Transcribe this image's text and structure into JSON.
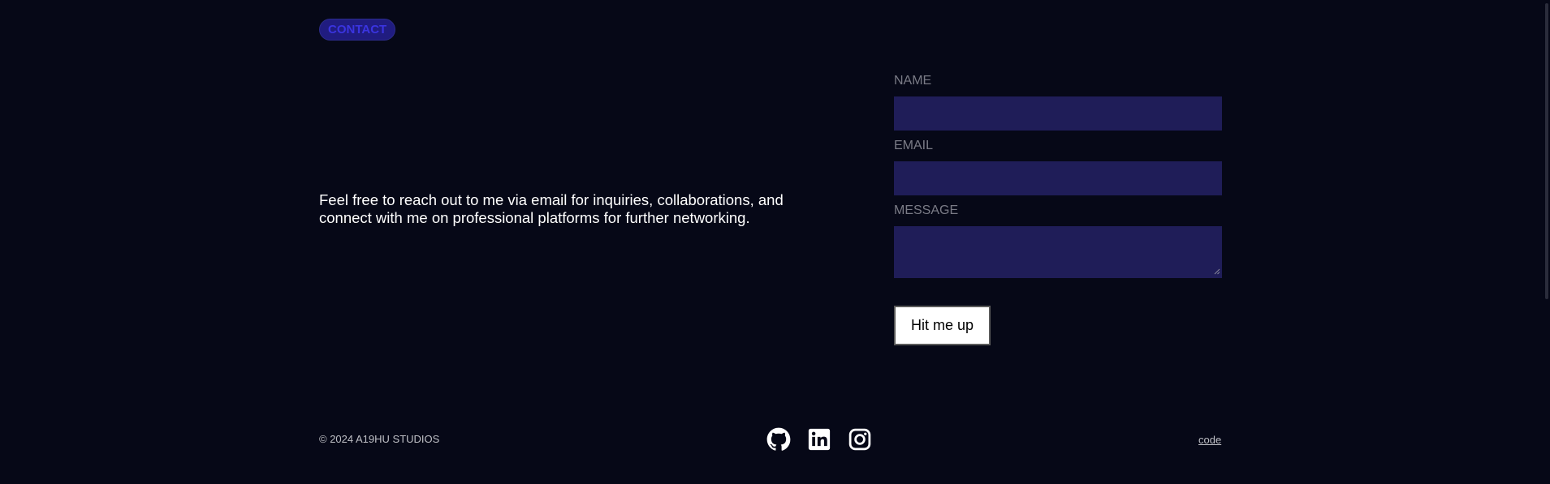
{
  "section_badge": "CONTACT",
  "intro_text": "Feel free to reach out to me via email for inquiries, collaborations, and connect with me on professional platforms for further networking.",
  "form": {
    "name_label": "NAME",
    "name_value": "",
    "email_label": "EMAIL",
    "email_value": "",
    "message_label": "MESSAGE",
    "message_value": "",
    "submit_label": "Hit me up"
  },
  "footer": {
    "copyright": "© 2024 A19HU STUDIOS",
    "social_icons": [
      "github-icon",
      "linkedin-icon",
      "instagram-icon"
    ],
    "code_link": "code"
  },
  "colors": {
    "background": "#060817",
    "field_background": "#1f1d58",
    "badge_background": "#201c80",
    "badge_text": "#3a34e0",
    "label_text": "#7a7b86",
    "body_text": "#ffffff"
  }
}
